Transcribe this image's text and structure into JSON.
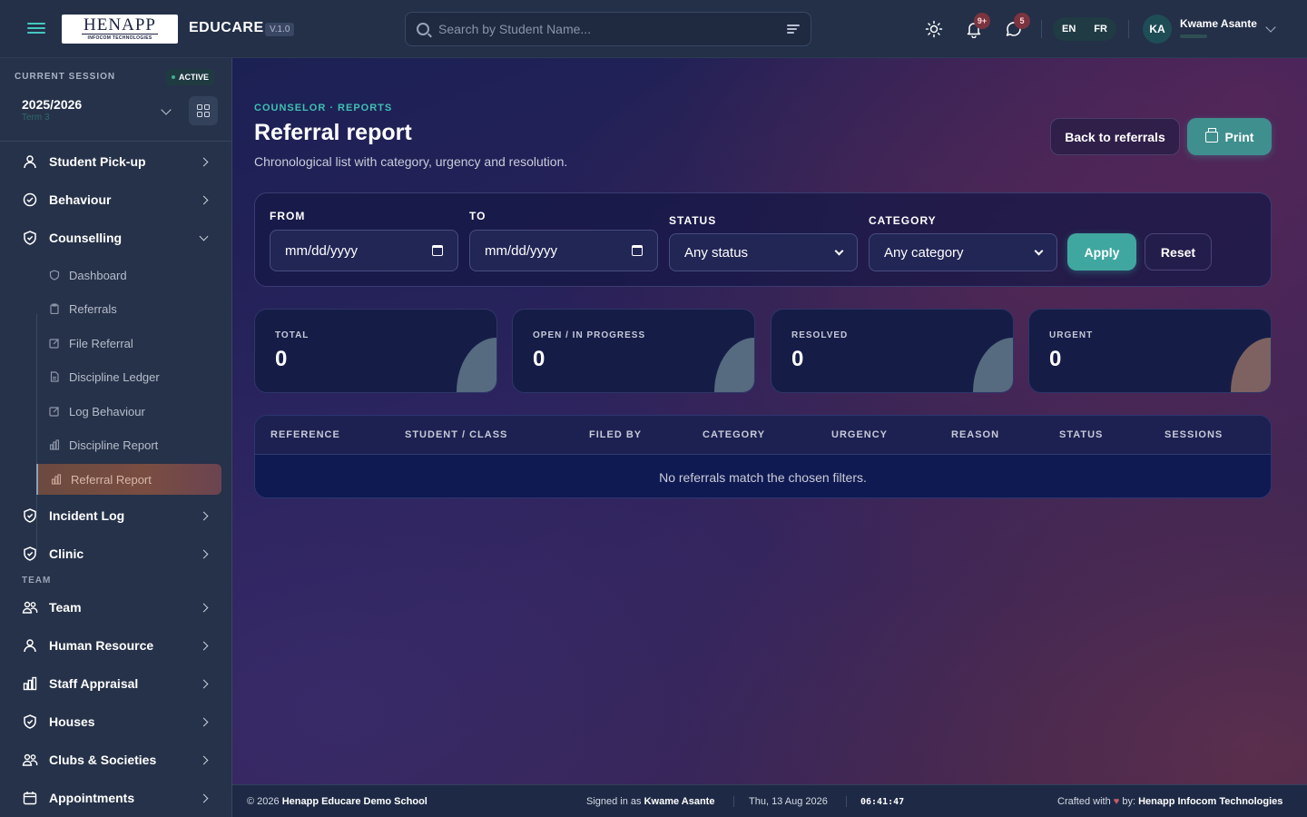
{
  "topbar": {
    "logo_text": "HENAPP",
    "logo_subtext": "INFOCOM TECHNOLOGIES",
    "brand": "EDUCARE",
    "version": "V.1.0",
    "search_placeholder": "Search by Student Name...",
    "notifications_badge": "9+",
    "messages_badge": "5",
    "lang_en": "EN",
    "lang_fr": "FR",
    "user_initials": "KA",
    "user_name": "Kwame Asante"
  },
  "sidebar": {
    "session_label": "CURRENT SESSION",
    "session_status": "ACTIVE",
    "session_year": "2025/2026",
    "session_term": "Term 3",
    "items": [
      {
        "label": "Student Pick-up"
      },
      {
        "label": "Behaviour"
      },
      {
        "label": "Counselling"
      },
      {
        "label": "Incident Log"
      },
      {
        "label": "Clinic"
      }
    ],
    "counselling_sub": [
      {
        "label": "Dashboard"
      },
      {
        "label": "Referrals"
      },
      {
        "label": "File Referral"
      },
      {
        "label": "Discipline Ledger"
      },
      {
        "label": "Log Behaviour"
      },
      {
        "label": "Discipline Report"
      },
      {
        "label": "Referral Report"
      }
    ],
    "team_section": "TEAM",
    "team_items": [
      {
        "label": "Team"
      },
      {
        "label": "Human Resource"
      },
      {
        "label": "Staff Appraisal"
      },
      {
        "label": "Houses"
      },
      {
        "label": "Clubs & Societies"
      },
      {
        "label": "Appointments"
      }
    ]
  },
  "main": {
    "breadcrumb": "COUNSELOR · REPORTS",
    "title": "Referral report",
    "description": "Chronological list with category, urgency and resolution.",
    "back_button": "Back to referrals",
    "print_button": "Print",
    "filters": {
      "from_label": "FROM",
      "to_label": "TO",
      "status_label": "STATUS",
      "category_label": "CATEGORY",
      "from_value": "mm/dd/yyyy",
      "to_value": "mm/dd/yyyy",
      "status_value": "Any status",
      "category_value": "Any category",
      "apply": "Apply",
      "reset": "Reset"
    },
    "stats": [
      {
        "label": "TOTAL",
        "value": "0"
      },
      {
        "label": "OPEN / IN PROGRESS",
        "value": "0"
      },
      {
        "label": "RESOLVED",
        "value": "0"
      },
      {
        "label": "URGENT",
        "value": "0"
      }
    ],
    "table": {
      "columns": [
        "REFERENCE",
        "STUDENT / CLASS",
        "FILED BY",
        "CATEGORY",
        "URGENCY",
        "REASON",
        "STATUS",
        "SESSIONS"
      ],
      "empty_message": "No referrals match the chosen filters."
    }
  },
  "footer": {
    "copyright_prefix": "© 2026",
    "school": "Henapp Educare Demo School",
    "signed_in_prefix": "Signed in as",
    "signed_in_user": "Kwame Asante",
    "date": "Thu, 13 Aug 2026",
    "time": "06:41:47",
    "crafted_prefix": "Crafted with",
    "crafted_suffix": "by:",
    "crafted_by": "Henapp Infocom Technologies"
  },
  "colors": {
    "accent": "#40a7a0",
    "breadcrumb": "#3fc0b2",
    "active_item": "#7a4d42"
  }
}
